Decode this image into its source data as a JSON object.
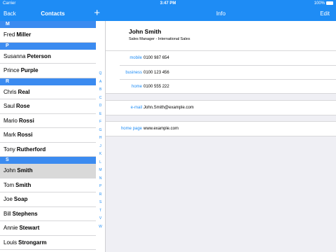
{
  "status_bar": {
    "carrier": "Carrier",
    "time": "3:47 PM",
    "battery": "100%"
  },
  "list_nav": {
    "back_label": "Back",
    "title": "Contacts",
    "add_label": "+"
  },
  "detail_nav": {
    "title": "Info",
    "edit_label": "Edit"
  },
  "contacts": {
    "sections": [
      {
        "letter": "M",
        "rows": [
          {
            "first": "Fred",
            "last": "Miller"
          }
        ]
      },
      {
        "letter": "P",
        "rows": [
          {
            "first": "Susanna",
            "last": "Peterson"
          },
          {
            "first": "Prince",
            "last": "Purple"
          }
        ]
      },
      {
        "letter": "R",
        "rows": [
          {
            "first": "Chris",
            "last": "Real"
          },
          {
            "first": "Saul",
            "last": "Rose"
          },
          {
            "first": "Mario",
            "last": "Rossi"
          },
          {
            "first": "Mark",
            "last": "Rossi"
          },
          {
            "first": "Tony",
            "last": "Rutherford"
          }
        ]
      },
      {
        "letter": "S",
        "rows": [
          {
            "first": "John",
            "last": "Smith",
            "selected": true
          },
          {
            "first": "Tom",
            "last": "Smith"
          },
          {
            "first": "Joe",
            "last": "Soap"
          },
          {
            "first": "Bill",
            "last": "Stephens"
          },
          {
            "first": "Annie",
            "last": "Stewart"
          },
          {
            "first": "Louis",
            "last": "Strongarm"
          }
        ]
      }
    ]
  },
  "index_letters": [
    "Q",
    "A",
    "B",
    "C",
    "D",
    "E",
    "F",
    "G",
    "H",
    "J",
    "K",
    "L",
    "M",
    "N",
    "P",
    "R",
    "S",
    "T",
    "V",
    "W"
  ],
  "contact_detail": {
    "name": "John Smith",
    "job_title": "Sales Manager - International Sales",
    "phones": [
      {
        "label": "mobile",
        "value": "0100 987 654"
      },
      {
        "label": "business",
        "value": "0100 123 456"
      },
      {
        "label": "home",
        "value": "0100 555 222"
      }
    ],
    "email": {
      "label": "e-mail",
      "value": "John.Smith@example.com"
    },
    "homepage": {
      "label": "home page",
      "value": "www.example.com"
    }
  },
  "colors": {
    "accent": "#1e8cf5",
    "section_header": "#3b8bf0",
    "selected_row": "#d9d9d9",
    "detail_background": "#efeff4"
  }
}
